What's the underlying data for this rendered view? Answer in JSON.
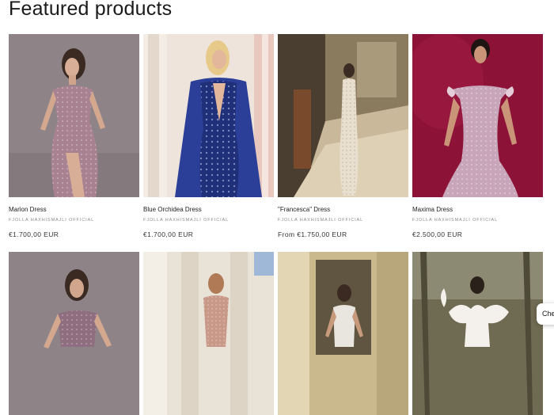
{
  "section": {
    "title": "Featured products"
  },
  "products": [
    {
      "name": "Marion Dress",
      "vendor": "FJOLLA HAXHISMAJLI OFFICIAL",
      "price": "€1.700,00 EUR"
    },
    {
      "name": "Blue Orchidea Dress",
      "vendor": "FJOLLA HAXHISMAJLI OFFICIAL",
      "price": "€1.700,00 EUR"
    },
    {
      "name": "\"Francesca\" Dress",
      "vendor": "FJOLLA HAXHISMAJLI OFFICIAL",
      "price": "From €1.750,00 EUR"
    },
    {
      "name": "Maxima Dress",
      "vendor": "FJOLLA HAXHISMAJLI OFFICIAL",
      "price": "€2.500,00 EUR"
    }
  ],
  "chat": {
    "label": "Che"
  },
  "colors": {
    "accent_magenta": "#8c1237",
    "dress_blue": "#1f2f7a",
    "background": "#ffffff"
  }
}
